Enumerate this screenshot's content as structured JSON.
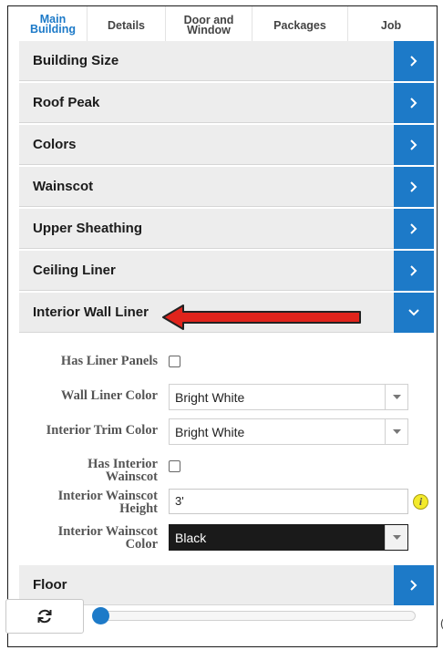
{
  "tabs": [
    {
      "label": "Main\nBuilding",
      "active": true
    },
    {
      "label": "Details",
      "active": false
    },
    {
      "label": "Door and\nWindow",
      "active": false
    },
    {
      "label": "Packages",
      "active": false
    },
    {
      "label": "Job",
      "active": false
    }
  ],
  "sections": {
    "building_size": "Building Size",
    "roof_peak": "Roof Peak",
    "colors": "Colors",
    "wainscot": "Wainscot",
    "upper_sheathing": "Upper Sheathing",
    "ceiling_liner": "Ceiling Liner",
    "interior_wall_liner": "Interior Wall Liner",
    "floor": "Floor"
  },
  "form": {
    "has_liner_panels_label": "Has Liner Panels",
    "has_liner_panels_checked": false,
    "wall_liner_color_label": "Wall Liner Color",
    "wall_liner_color_value": "Bright White",
    "interior_trim_color_label": "Interior Trim Color",
    "interior_trim_color_value": "Bright White",
    "has_interior_wainscot_label_1": "Has Interior",
    "has_interior_wainscot_label_2": "Wainscot",
    "has_interior_wainscot_checked": false,
    "interior_wainscot_height_label_1": "Interior Wainscot",
    "interior_wainscot_height_label_2": "Height",
    "interior_wainscot_height_value": "3'",
    "interior_wainscot_color_label_1": "Interior Wainscot",
    "interior_wainscot_color_label_2": "Color",
    "interior_wainscot_color_value": "Black",
    "info_icon_text": "i"
  },
  "colors": {
    "accent": "#1d7ac8",
    "section_bg": "#ededed",
    "annotation_arrow": "#e0241c"
  },
  "icons": {
    "expand": "chevron-right-icon",
    "collapse": "chevron-down-icon",
    "refresh": "refresh-icon",
    "info": "info-icon"
  },
  "edge_char": "("
}
